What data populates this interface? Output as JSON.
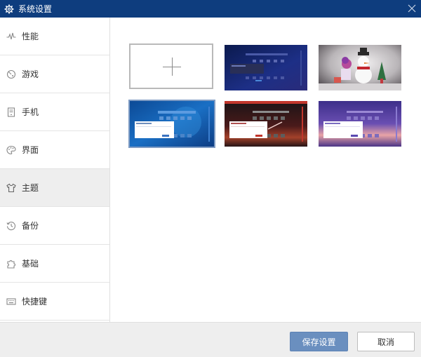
{
  "window": {
    "title": "系统设置"
  },
  "sidebar": {
    "items": [
      {
        "label": "性能",
        "icon": "pulse-icon"
      },
      {
        "label": "游戏",
        "icon": "game-icon"
      },
      {
        "label": "手机",
        "icon": "phone-icon"
      },
      {
        "label": "界面",
        "icon": "palette-icon"
      },
      {
        "label": "主题",
        "icon": "shirt-icon",
        "active": true
      },
      {
        "label": "备份",
        "icon": "history-icon"
      },
      {
        "label": "基础",
        "icon": "puzzle-icon"
      },
      {
        "label": "快捷键",
        "icon": "keyboard-icon"
      }
    ]
  },
  "themes": {
    "add_tile_icon": "plus-icon",
    "items": [
      {
        "name": "dark-blue-theme"
      },
      {
        "name": "snowman-theme"
      },
      {
        "name": "blue-theme",
        "selected": true
      },
      {
        "name": "red-dark-theme"
      },
      {
        "name": "purple-sunset-theme"
      }
    ]
  },
  "footer": {
    "save_label": "保存设置",
    "cancel_label": "取消"
  },
  "colors": {
    "titlebar": "#0e3d7e",
    "accent": "#6a8fbf",
    "selected_outline": "#7e9bc3"
  }
}
